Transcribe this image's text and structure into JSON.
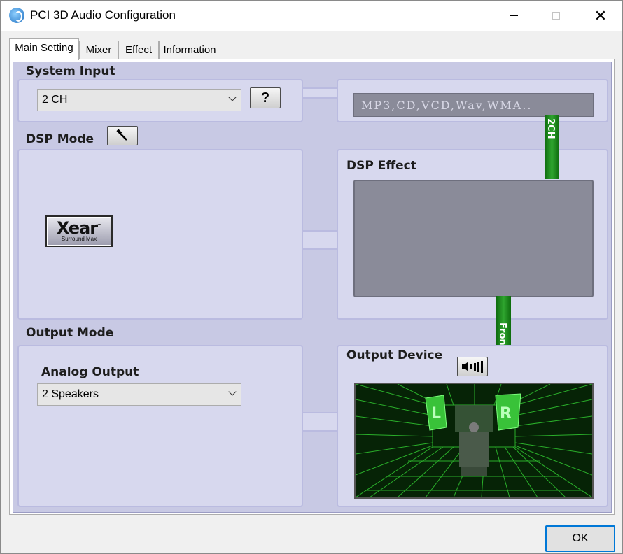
{
  "window": {
    "title": "PCI 3D Audio Configuration",
    "icon": "app-icon",
    "close_glyph": "✕"
  },
  "tabs": [
    {
      "label": "Main Setting",
      "active": true
    },
    {
      "label": "Mixer",
      "active": false
    },
    {
      "label": "Effect",
      "active": false
    },
    {
      "label": "Information",
      "active": false
    }
  ],
  "system_input": {
    "label": "System Input",
    "selected": "2 CH",
    "help_label": "?",
    "formats": "MP3,CD,VCD,Wav,WMA..",
    "channel_pipe": "2CH"
  },
  "dsp_mode": {
    "label": "DSP Mode",
    "logo_main": "Xear",
    "logo_tm": "™",
    "logo_sub": "Surround Max"
  },
  "dsp_effect": {
    "label": "DSP Effect",
    "pipe": "Front"
  },
  "output_mode": {
    "label": "Output Mode",
    "sub_label": "Analog Output",
    "selected": "2 Speakers"
  },
  "output_device": {
    "label": "Output Device",
    "speakers": [
      "L",
      "R"
    ]
  },
  "footer": {
    "ok_label": "OK"
  },
  "colors": {
    "panel": "#c8c9e4",
    "box": "#d7d8ee",
    "screen": "#8a8b99",
    "pipe_green": "#1e8a1e",
    "room_grid": "#2fbf2f"
  }
}
